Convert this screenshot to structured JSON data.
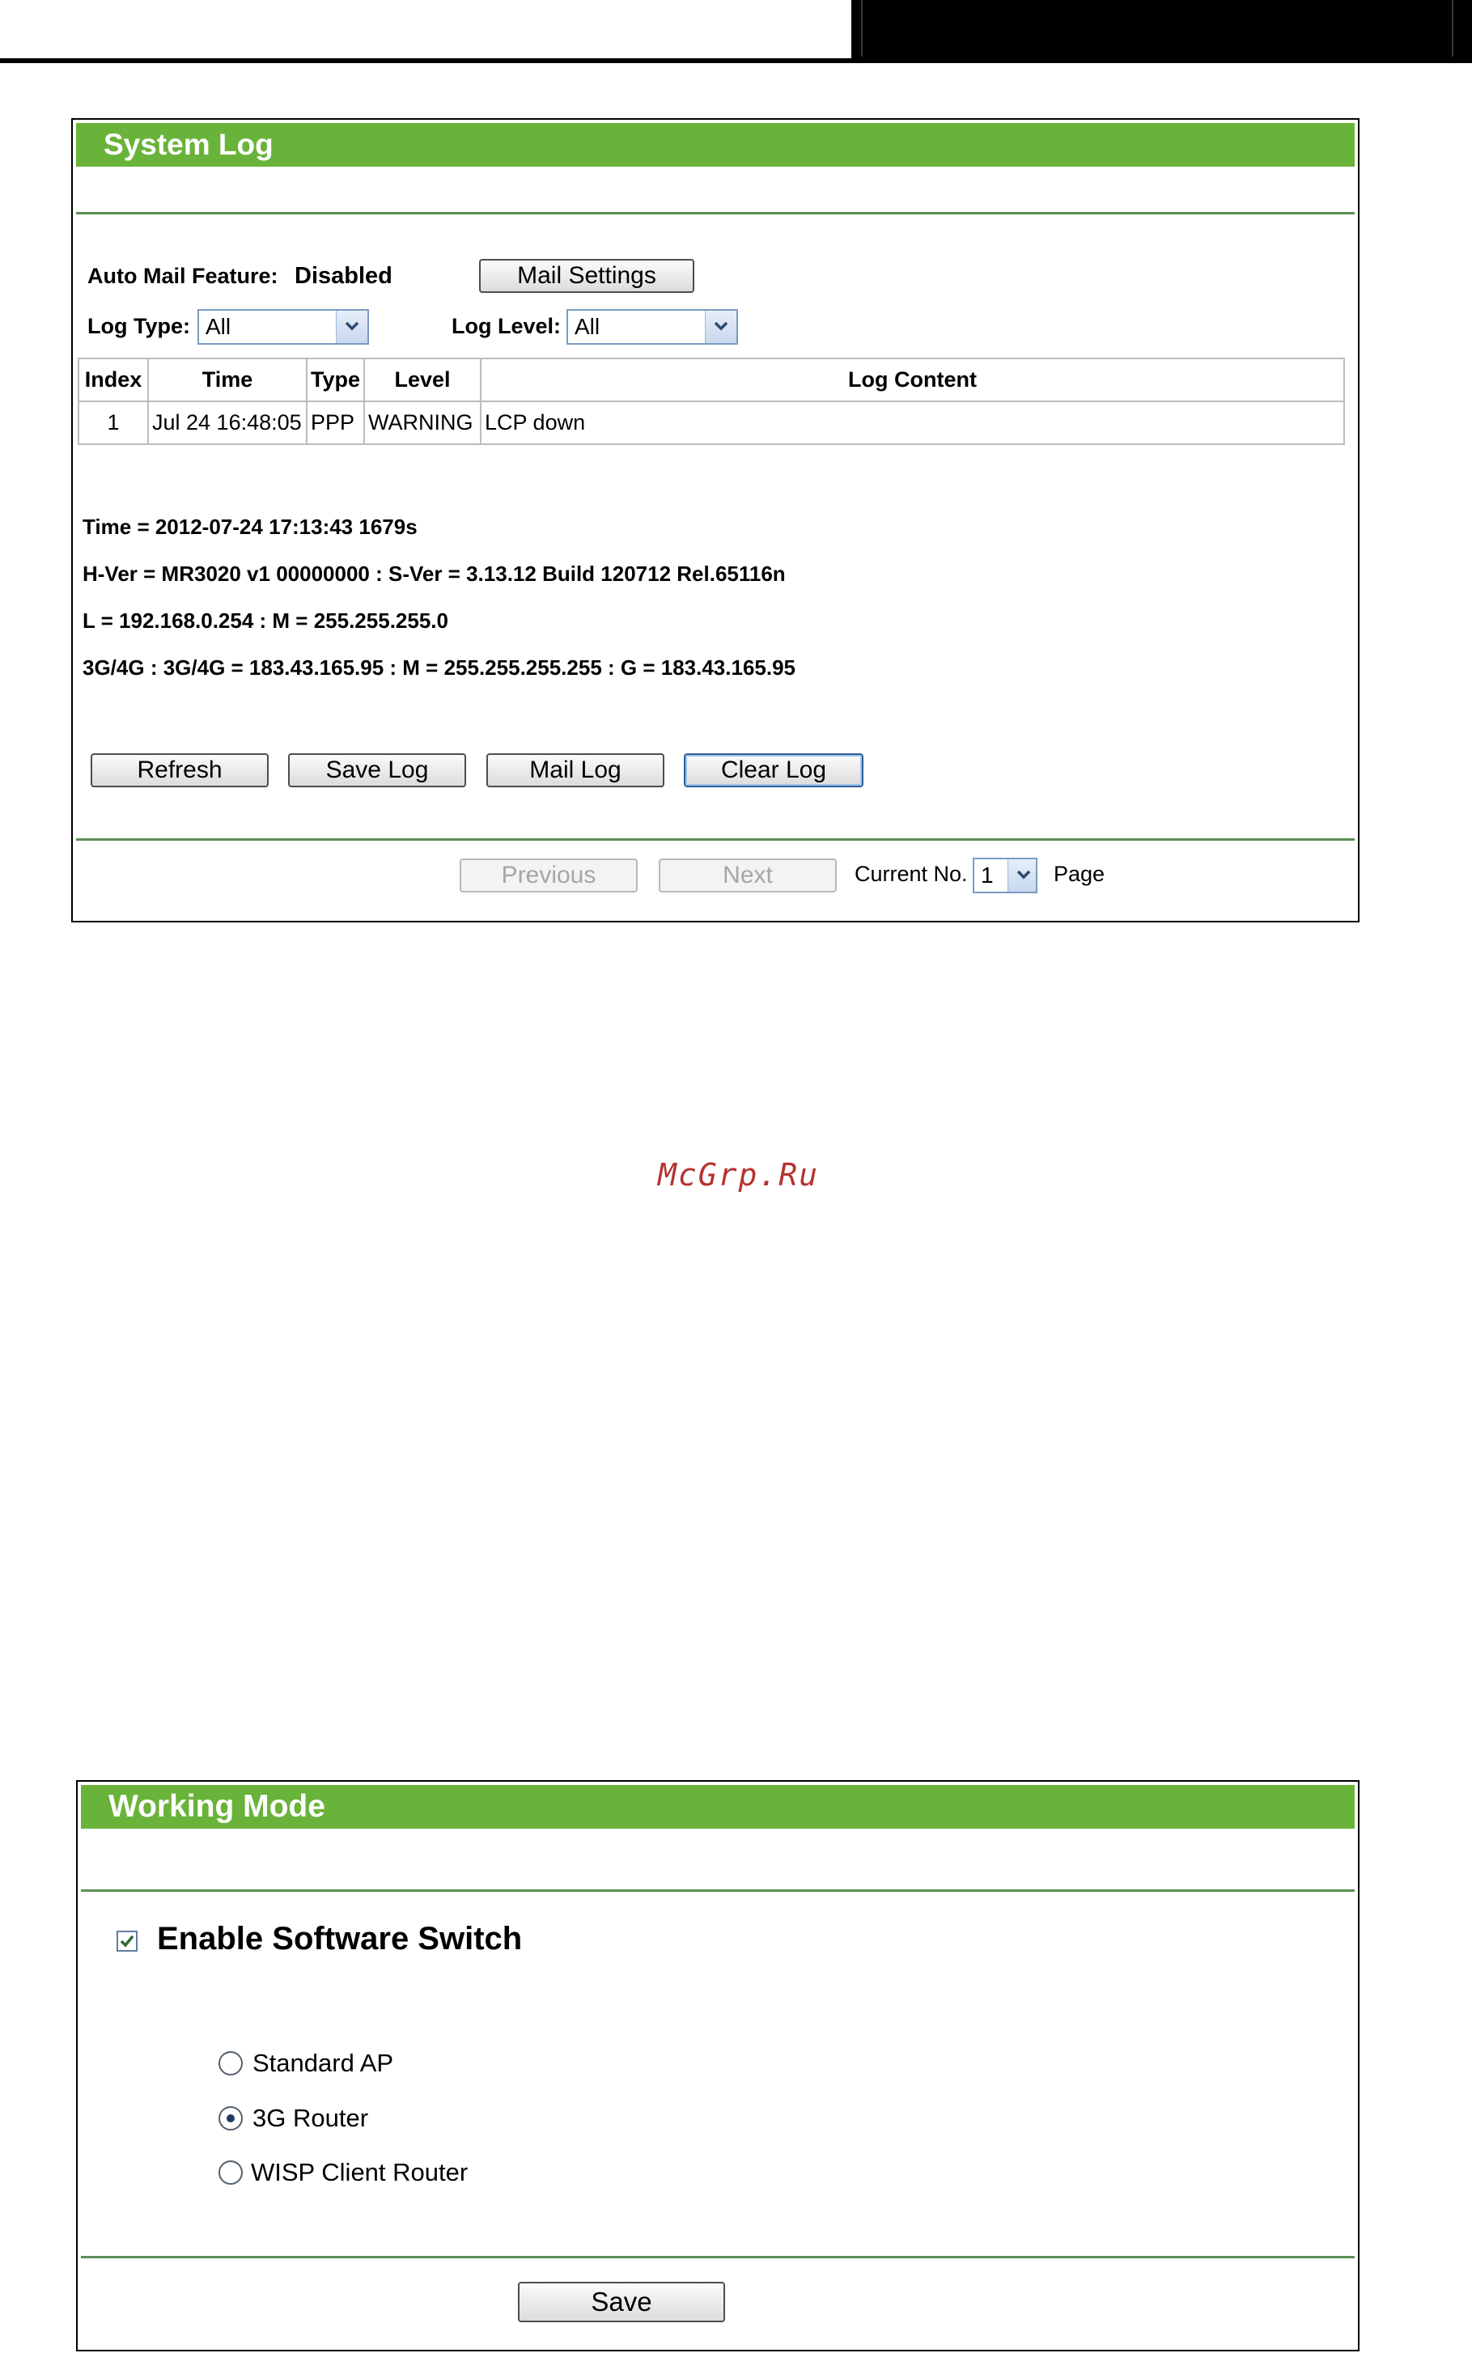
{
  "system_log": {
    "title": "System Log",
    "auto_mail_label": "Auto Mail Feature:",
    "auto_mail_value": "Disabled",
    "mail_settings_button": "Mail Settings",
    "log_type_label": "Log Type:",
    "log_type_value": "All",
    "log_level_label": "Log Level:",
    "log_level_value": "All",
    "table": {
      "headers": [
        "Index",
        "Time",
        "Type",
        "Level",
        "Log Content"
      ],
      "rows": [
        [
          "1",
          "Jul 24 16:48:05",
          "PPP",
          "WARNING",
          "LCP down"
        ]
      ]
    },
    "info_lines": [
      "Time = 2012-07-24 17:13:43 1679s",
      "H-Ver = MR3020 v1 00000000 : S-Ver = 3.13.12 Build 120712 Rel.65116n",
      "L = 192.168.0.254 : M = 255.255.255.0",
      "3G/4G : 3G/4G = 183.43.165.95 : M = 255.255.255.255 : G = 183.43.165.95"
    ],
    "buttons": {
      "refresh": "Refresh",
      "save_log": "Save Log",
      "mail_log": "Mail Log",
      "clear_log": "Clear Log"
    },
    "pager": {
      "previous": "Previous",
      "next": "Next",
      "current_label": "Current No.",
      "current_value": "1",
      "page_label": "Page"
    }
  },
  "watermark": "McGrp.Ru",
  "working_mode": {
    "title": "Working Mode",
    "enable_label": "Enable Software Switch",
    "enable_checked": true,
    "options": [
      {
        "label": "Standard AP",
        "selected": false
      },
      {
        "label": "3G Router",
        "selected": true
      },
      {
        "label": "WISP Client Router",
        "selected": false
      }
    ],
    "save_button": "Save"
  },
  "icons": {
    "dropdown": "chevron-down-icon",
    "checkbox": "checkmark-icon"
  }
}
